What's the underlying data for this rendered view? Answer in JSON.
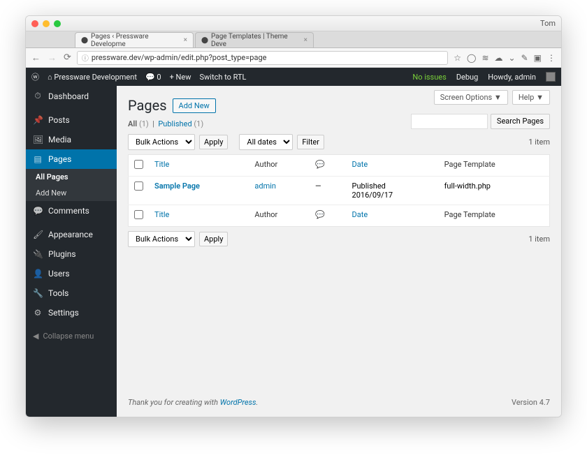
{
  "os": {
    "user": "Tom"
  },
  "browser": {
    "tabs": [
      {
        "title": "Pages ‹ Pressware Developme",
        "active": true
      },
      {
        "title": "Page Templates | Theme Deve",
        "active": false
      }
    ],
    "url": "pressware.dev/wp-admin/edit.php?post_type=page"
  },
  "adminbar": {
    "site": "Pressware Development",
    "comments": "0",
    "new": "New",
    "rtl": "Switch to RTL",
    "noissues": "No issues",
    "debug": "Debug",
    "howdy": "Howdy, admin"
  },
  "sidebar": {
    "items": [
      {
        "icon": "dashboard",
        "label": "Dashboard"
      },
      {
        "icon": "pin",
        "label": "Posts"
      },
      {
        "icon": "media",
        "label": "Media"
      },
      {
        "icon": "page",
        "label": "Pages",
        "current": true
      },
      {
        "icon": "comment",
        "label": "Comments"
      },
      {
        "icon": "appearance",
        "label": "Appearance"
      },
      {
        "icon": "plugin",
        "label": "Plugins"
      },
      {
        "icon": "user",
        "label": "Users"
      },
      {
        "icon": "tool",
        "label": "Tools"
      },
      {
        "icon": "settings",
        "label": "Settings"
      }
    ],
    "submenu": [
      {
        "label": "All Pages",
        "active": true
      },
      {
        "label": "Add New",
        "active": false
      }
    ],
    "collapse": "Collapse menu"
  },
  "screen": {
    "options": "Screen Options",
    "help": "Help"
  },
  "page": {
    "title": "Pages",
    "addnew": "Add New",
    "filters": {
      "all": "All",
      "all_count": "(1)",
      "published": "Published",
      "published_count": "(1)"
    },
    "search": {
      "button": "Search Pages"
    },
    "bulk": {
      "label": "Bulk Actions",
      "apply": "Apply"
    },
    "datefilter": {
      "label": "All dates",
      "filter": "Filter"
    },
    "count": "1 item",
    "columns": {
      "title": "Title",
      "author": "Author",
      "date": "Date",
      "template": "Page Template"
    },
    "rows": [
      {
        "title": "Sample Page",
        "author": "admin",
        "comments": "—",
        "date_status": "Published",
        "date": "2016/09/17",
        "template": "full-width.php"
      }
    ]
  },
  "footer": {
    "thanks": "Thank you for creating with ",
    "wp": "WordPress",
    "period": ".",
    "version": "Version 4.7"
  }
}
